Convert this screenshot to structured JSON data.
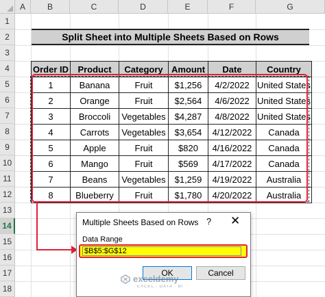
{
  "columns": [
    "A",
    "B",
    "C",
    "D",
    "E",
    "F",
    "G"
  ],
  "rows": [
    "1",
    "2",
    "3",
    "4",
    "5",
    "6",
    "7",
    "8",
    "9",
    "10",
    "11",
    "12",
    "13",
    "14",
    "15",
    "16",
    "17",
    "18"
  ],
  "title": "Split Sheet into Multiple Sheets Based on Rows",
  "table": {
    "headers": [
      "Order ID",
      "Product",
      "Category",
      "Amount",
      "Date",
      "Country"
    ],
    "rows": [
      [
        "1",
        "Banana",
        "Fruit",
        "$1,256",
        "4/2/2022",
        "United States"
      ],
      [
        "2",
        "Orange",
        "Fruit",
        "$2,564",
        "4/6/2022",
        "United States"
      ],
      [
        "3",
        "Broccoli",
        "Vegetables",
        "$4,287",
        "4/8/2022",
        "United States"
      ],
      [
        "4",
        "Carrots",
        "Vegetables",
        "$3,654",
        "4/12/2022",
        "Canada"
      ],
      [
        "5",
        "Apple",
        "Fruit",
        "$820",
        "4/16/2022",
        "Canada"
      ],
      [
        "6",
        "Mango",
        "Fruit",
        "$569",
        "4/17/2022",
        "Canada"
      ],
      [
        "7",
        "Beans",
        "Vegetables",
        "$1,259",
        "4/19/2022",
        "Australia"
      ],
      [
        "8",
        "Blueberry",
        "Fruit",
        "$1,780",
        "4/20/2022",
        "Australia"
      ]
    ]
  },
  "dialog": {
    "title": "Multiple Sheets Based on Rows",
    "help": "?",
    "close": "✕",
    "label": "Data Range",
    "range_value": "$B$5:$G$12",
    "ok_label": "OK",
    "cancel_label": "Cancel"
  },
  "watermark": {
    "name": "exceldemy",
    "tagline": "EXCEL · DATA · BI"
  },
  "colors": {
    "highlight": "#e0203a",
    "input_fill": "#ffff00",
    "header_fill": "#d0d0d0",
    "selected_row": "#217346"
  }
}
